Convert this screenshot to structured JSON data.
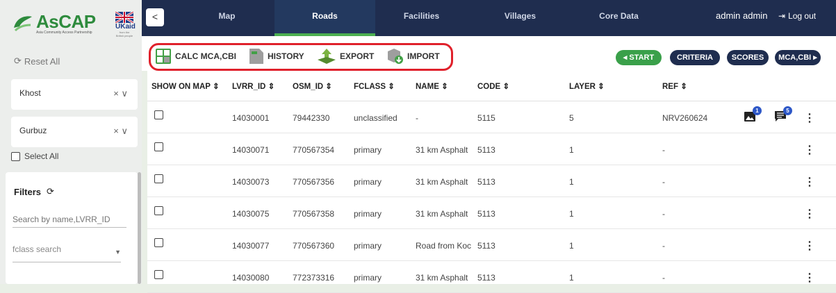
{
  "brand": {
    "logo_text": "AsCAP",
    "logo_sub": "Asia Community Access Partnership",
    "partner": "UKaid",
    "partner_sub": "from the British people"
  },
  "sidebar": {
    "reset_label": "Reset All",
    "province": {
      "value": "Khost",
      "clear": "×",
      "chevron": "∨"
    },
    "district": {
      "value": "Gurbuz",
      "clear": "×",
      "chevron": "∨"
    },
    "select_all_label": "Select All",
    "filters_title": "Filters",
    "search_placeholder": "Search by name,LVRR_ID",
    "fclass_placeholder": "fclass search"
  },
  "nav": {
    "collapse": "<",
    "tabs": [
      "Map",
      "Roads",
      "Facilities",
      "Villages",
      "Core Data"
    ],
    "active_tab": "Roads",
    "user": "admin admin",
    "logout": "Log out"
  },
  "toolbar": {
    "calc_label": "CALC MCA,CBI",
    "history_label": "HISTORY",
    "export_label": "EXPORT",
    "import_label": "IMPORT",
    "start_label": "START",
    "criteria_label": "CRITERIA",
    "scores_label": "SCORES",
    "mca_label": "MCA,CBI"
  },
  "table": {
    "headers": [
      "SHOW ON MAP",
      "LVRR_ID",
      "OSM_ID",
      "FCLASS",
      "NAME",
      "CODE",
      "LAYER",
      "REF"
    ],
    "sort_glyph": "⇕",
    "rows": [
      {
        "lvrr_id": "14030001",
        "osm_id": "79442330",
        "fclass": "unclassified",
        "name": "-",
        "code": "5115",
        "layer": "5",
        "ref": "NRV260624",
        "photos": "1",
        "comments": "5"
      },
      {
        "lvrr_id": "14030071",
        "osm_id": "770567354",
        "fclass": "primary",
        "name": "31 km Asphalt",
        "code": "5113",
        "layer": "1",
        "ref": "-"
      },
      {
        "lvrr_id": "14030073",
        "osm_id": "770567356",
        "fclass": "primary",
        "name": "31 km Asphalt",
        "code": "5113",
        "layer": "1",
        "ref": "-"
      },
      {
        "lvrr_id": "14030075",
        "osm_id": "770567358",
        "fclass": "primary",
        "name": "31 km Asphalt",
        "code": "5113",
        "layer": "1",
        "ref": "-"
      },
      {
        "lvrr_id": "14030077",
        "osm_id": "770567360",
        "fclass": "primary",
        "name": "Road from Koc",
        "code": "5113",
        "layer": "1",
        "ref": "-"
      },
      {
        "lvrr_id": "14030080",
        "osm_id": "772373316",
        "fclass": "primary",
        "name": "31 km Asphalt",
        "code": "5113",
        "layer": "1",
        "ref": "-"
      }
    ]
  },
  "colors": {
    "nav_bg": "#1f2d4f",
    "accent_green": "#3aa04a",
    "highlight_red": "#e0212b",
    "badge_blue": "#2d57c7"
  }
}
